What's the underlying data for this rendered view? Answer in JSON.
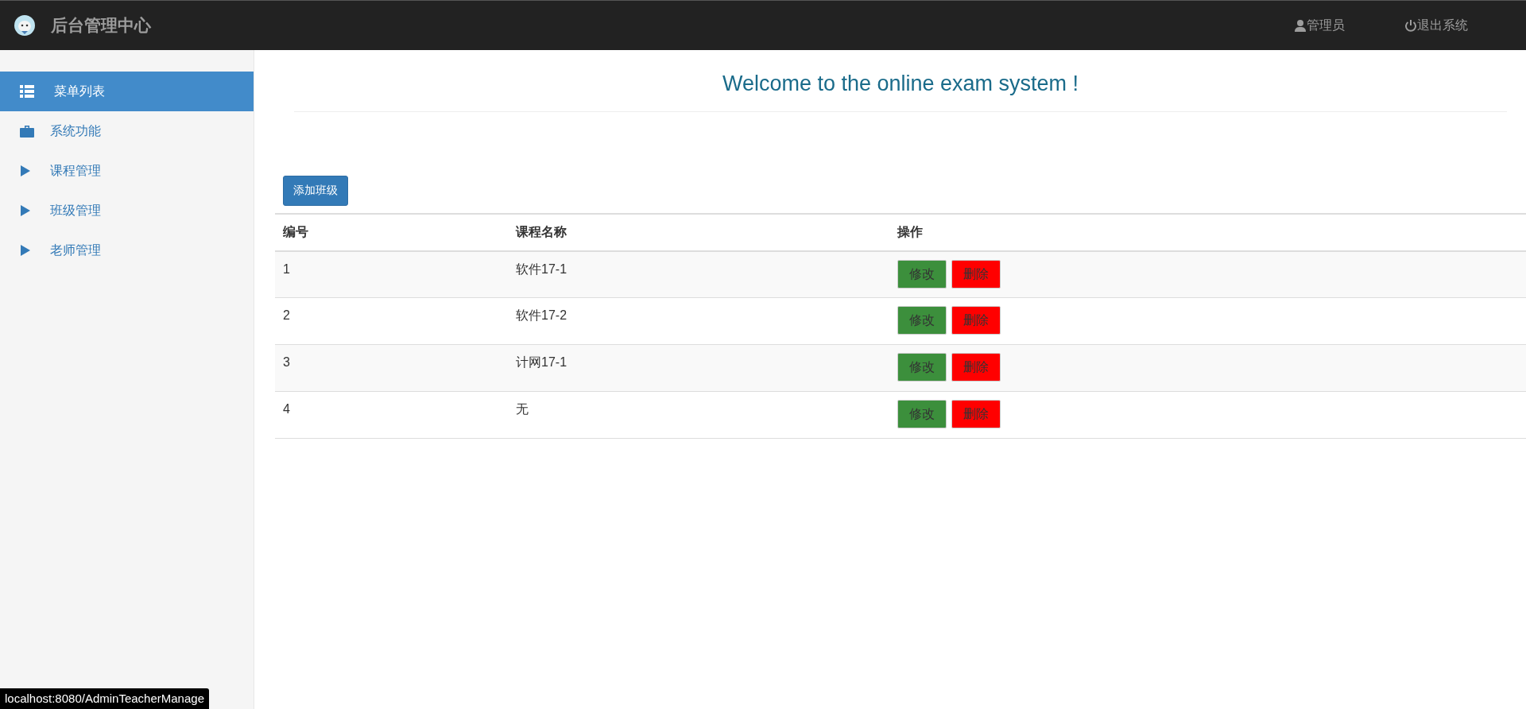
{
  "header": {
    "title": "后台管理中心",
    "user": "管理员",
    "logout": "退出系统"
  },
  "sidebar": {
    "items": [
      {
        "label": "菜单列表",
        "kind": "list",
        "selected": true
      },
      {
        "label": "系统功能",
        "kind": "briefcase",
        "selected": false
      },
      {
        "label": "课程管理",
        "kind": "triangle",
        "selected": false
      },
      {
        "label": "班级管理",
        "kind": "triangle",
        "selected": false
      },
      {
        "label": "老师管理",
        "kind": "triangle",
        "selected": false
      }
    ]
  },
  "page_title": "Welcome to the online exam system !",
  "add_button": "添加班级",
  "table": {
    "columns": [
      "编号",
      "课程名称",
      "操作"
    ],
    "rows": [
      {
        "id": "1",
        "name": "软件17-1",
        "edit": "修改",
        "delete": "删除"
      },
      {
        "id": "2",
        "name": "软件17-2",
        "edit": "修改",
        "delete": "删除"
      },
      {
        "id": "3",
        "name": "计网17-1",
        "edit": "修改",
        "delete": "删除"
      },
      {
        "id": "4",
        "name": "无",
        "edit": "修改",
        "delete": "删除"
      }
    ]
  },
  "status_bar": "localhost:8080/AdminTeacherManage"
}
